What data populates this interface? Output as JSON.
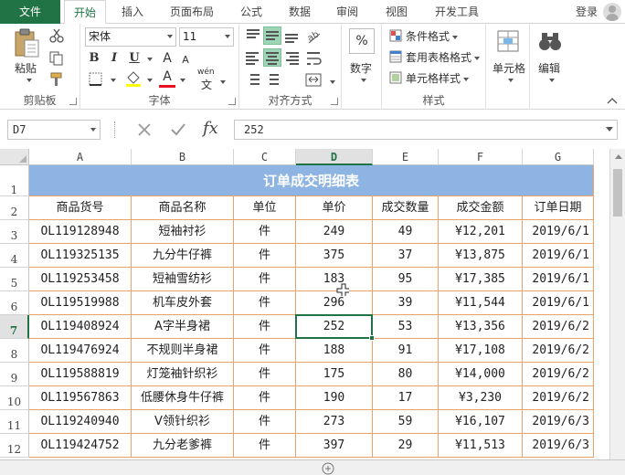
{
  "ribbon_tabs": {
    "file": "文件",
    "home": "开始",
    "insert": "插入",
    "page_layout": "页面布局",
    "formulas": "公式",
    "data": "数据",
    "review": "审阅",
    "view": "视图",
    "developer": "开发工具",
    "login": "登录"
  },
  "clipboard": {
    "paste": "粘贴",
    "group_label": "剪贴板"
  },
  "font": {
    "name": "宋体",
    "size": "11",
    "bold": "B",
    "italic": "I",
    "underline": "U",
    "grow": "A",
    "shrink": "A",
    "phonetic": "wén",
    "group_label": "字体"
  },
  "alignment": {
    "group_label": "对齐方式"
  },
  "number": {
    "format_label": "数字",
    "percent": "%"
  },
  "styles": {
    "conditional": "条件格式",
    "table": "套用表格格式",
    "cell_styles": "单元格样式",
    "group_label": "样式"
  },
  "cells": {
    "label": "单元格"
  },
  "editing": {
    "label": "编辑"
  },
  "formula_bar": {
    "name_box": "D7",
    "value": "252",
    "fx": "fx"
  },
  "columns": [
    "A",
    "B",
    "C",
    "D",
    "E",
    "F",
    "G"
  ],
  "title": "订单成交明细表",
  "headers": [
    "商品货号",
    "商品名称",
    "单位",
    "单价",
    "成交数量",
    "成交金额",
    "订单日期"
  ],
  "rows": [
    [
      "OL119128948",
      "短袖衬衫",
      "件",
      "249",
      "49",
      "¥12,201",
      "2019/6/1"
    ],
    [
      "OL119325135",
      "九分牛仔裤",
      "件",
      "375",
      "37",
      "¥13,875",
      "2019/6/1"
    ],
    [
      "OL119253458",
      "短袖雪纺衫",
      "件",
      "183",
      "95",
      "¥17,385",
      "2019/6/1"
    ],
    [
      "OL119519988",
      "机车皮外套",
      "件",
      "296",
      "39",
      "¥11,544",
      "2019/6/1"
    ],
    [
      "OL119408924",
      "A字半身裙",
      "件",
      "252",
      "53",
      "¥13,356",
      "2019/6/2"
    ],
    [
      "OL119476924",
      "不规则半身裙",
      "件",
      "188",
      "91",
      "¥17,108",
      "2019/6/2"
    ],
    [
      "OL119588819",
      "灯笼袖针织衫",
      "件",
      "175",
      "80",
      "¥14,000",
      "2019/6/2"
    ],
    [
      "OL119567863",
      "低腰休身牛仔裤",
      "件",
      "190",
      "17",
      "¥3,230",
      "2019/6/2"
    ],
    [
      "OL119240940",
      "V领针织衫",
      "件",
      "273",
      "59",
      "¥16,107",
      "2019/6/3"
    ],
    [
      "OL119424752",
      "九分老爹裤",
      "件",
      "397",
      "29",
      "¥11,513",
      "2019/6/3"
    ]
  ],
  "row_numbers": [
    "1",
    "2",
    "3",
    "4",
    "5",
    "6",
    "7",
    "8",
    "9",
    "10",
    "11",
    "12"
  ],
  "active_cell": "D7",
  "colors": {
    "excel_green": "#217346",
    "title_fill": "#8db4e2",
    "border_orange": "#e8a36a",
    "selected_align": "#9fd5b7"
  }
}
